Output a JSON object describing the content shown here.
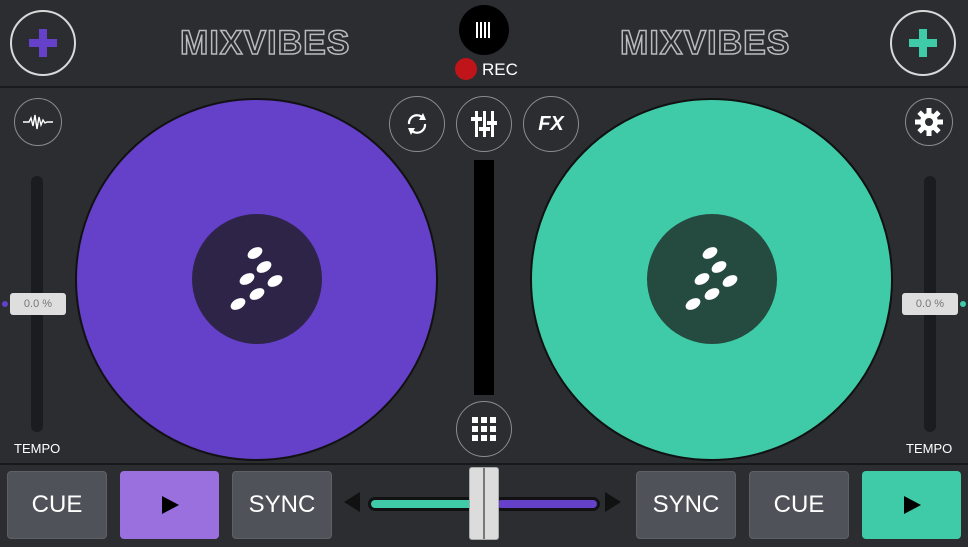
{
  "header": {
    "logo_left": "MIXVIBES",
    "logo_right": "MIXVIBES",
    "rec_label": "REC"
  },
  "icons": {
    "add_left": "plus-icon",
    "add_right": "plus-icon",
    "rec_button": "record-bars-icon",
    "waveform": "waveform-icon",
    "loop": "loop-icon",
    "mixer": "mixer-sliders-icon",
    "fx": "FX",
    "settings": "gear-icon",
    "pads": "grid-icon"
  },
  "deck_left": {
    "color": "#6540c9",
    "label_color": "#2e2448",
    "tempo_value": "0.0 %",
    "tempo_label": "TEMPO",
    "cue_label": "CUE",
    "sync_label": "SYNC"
  },
  "deck_right": {
    "color": "#3fcaa8",
    "label_color": "#254a3f",
    "tempo_value": "0.0 %",
    "tempo_label": "TEMPO",
    "cue_label": "CUE",
    "sync_label": "SYNC"
  },
  "colors": {
    "background": "#2b2d31",
    "purple": "#6540c9",
    "teal": "#3fcaa8",
    "play_left": "#9a6fde",
    "play_right": "#3fcaa8",
    "rec_red": "#c0141b"
  }
}
